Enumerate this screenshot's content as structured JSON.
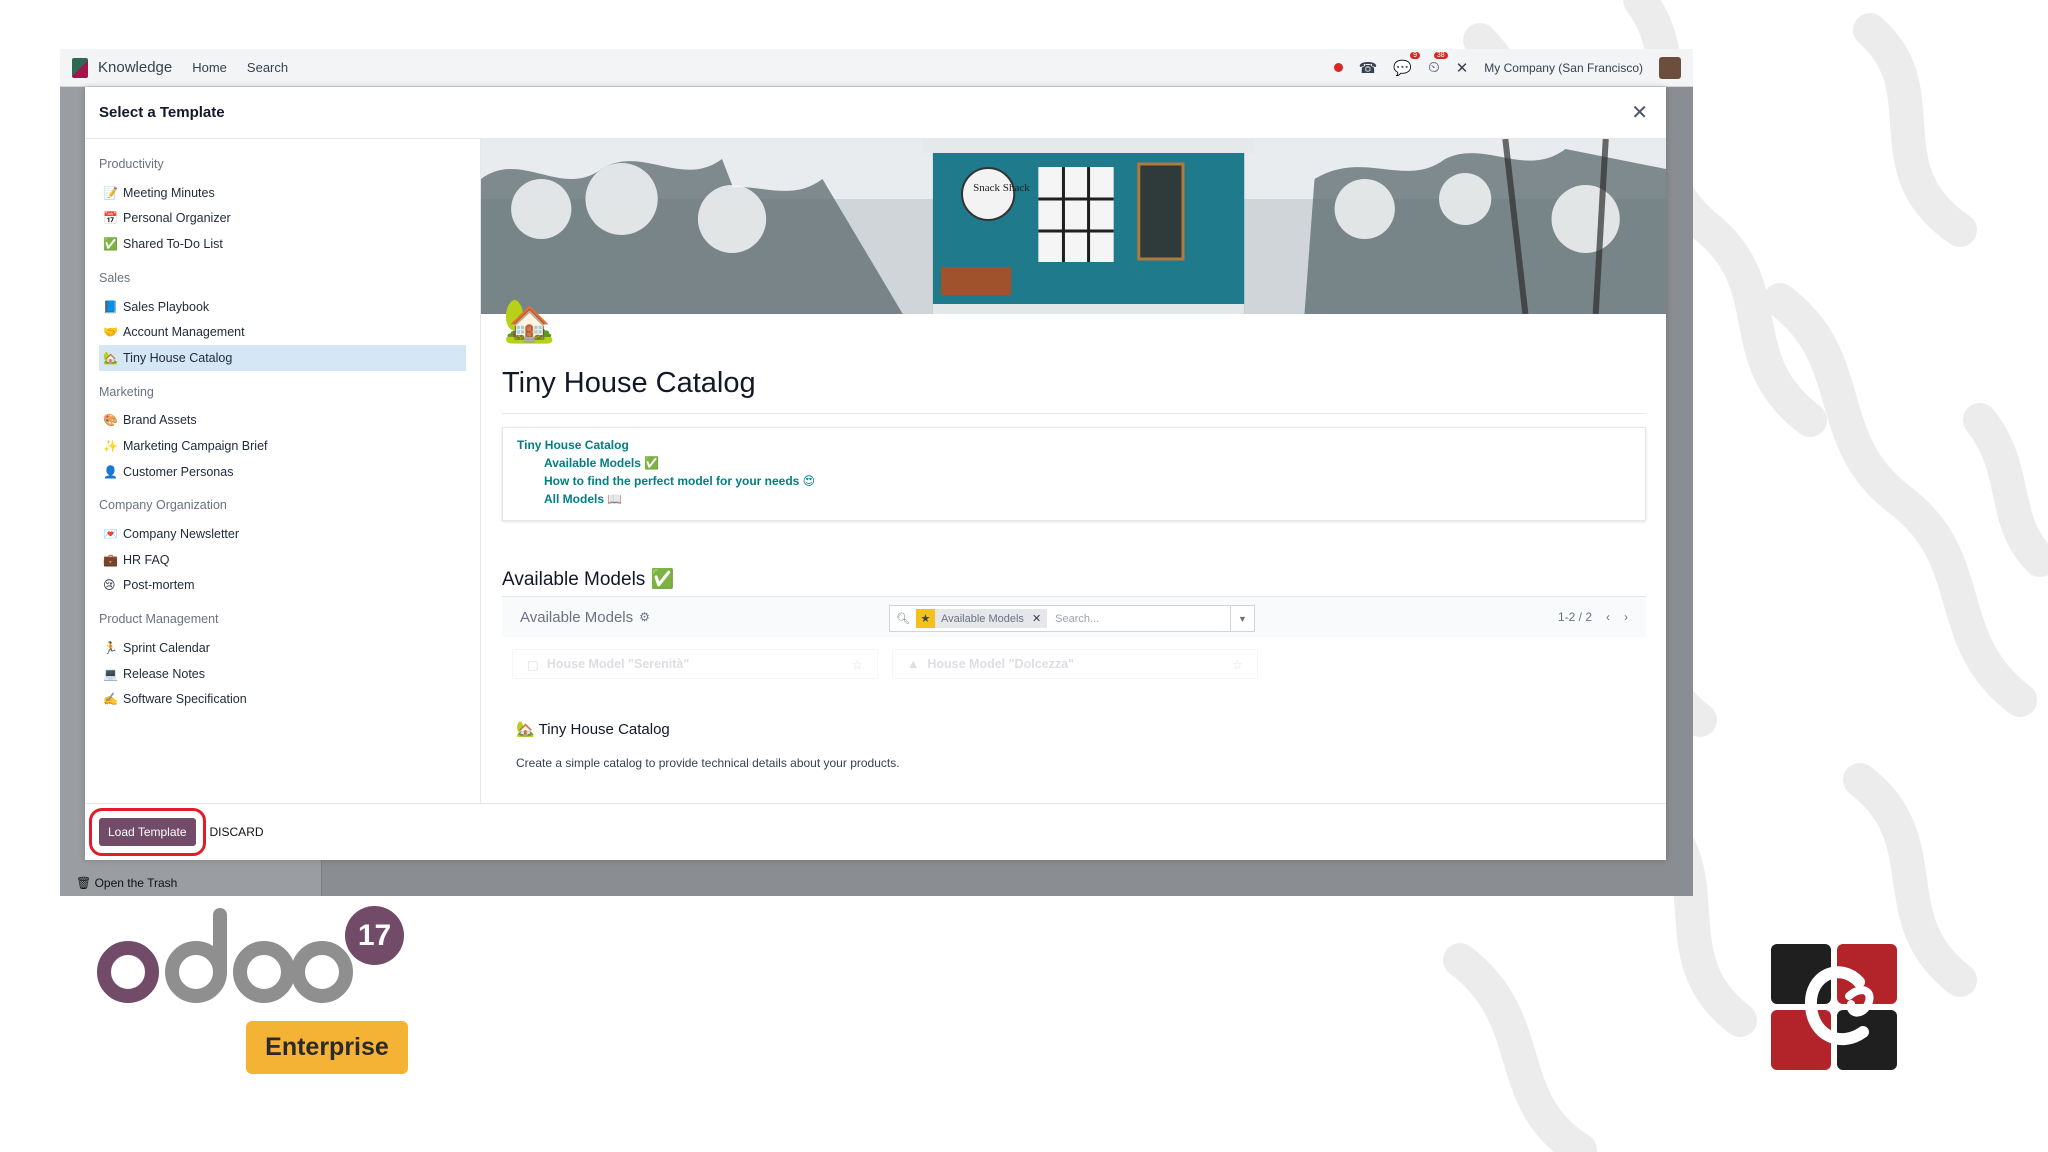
{
  "app": {
    "name": "Knowledge",
    "menu": [
      "Home",
      "Search"
    ],
    "company": "My Company (San Francisco)",
    "badge_chat": "9",
    "badge_activity": "38",
    "trash_label": "Open the Trash",
    "trash_icon": "trash-icon"
  },
  "modal": {
    "title": "Select a Template",
    "categories": [
      {
        "title": "Productivity",
        "items": [
          {
            "emoji": "📝",
            "label": "Meeting Minutes"
          },
          {
            "emoji": "📅",
            "label": "Personal Organizer"
          },
          {
            "emoji": "✅",
            "label": "Shared To-Do List"
          }
        ]
      },
      {
        "title": "Sales",
        "items": [
          {
            "emoji": "📘",
            "label": "Sales Playbook"
          },
          {
            "emoji": "🤝",
            "label": "Account Management"
          },
          {
            "emoji": "🏡",
            "label": "Tiny House Catalog"
          }
        ]
      },
      {
        "title": "Marketing",
        "items": [
          {
            "emoji": "🎨",
            "label": "Brand Assets"
          },
          {
            "emoji": "✨",
            "label": "Marketing Campaign Brief"
          },
          {
            "emoji": "👤",
            "label": "Customer Personas"
          }
        ]
      },
      {
        "title": "Company Organization",
        "items": [
          {
            "emoji": "💌",
            "label": "Company Newsletter"
          },
          {
            "emoji": "💼",
            "label": "HR FAQ"
          },
          {
            "emoji": "😢",
            "label": "Post-mortem"
          }
        ]
      },
      {
        "title": "Product Management",
        "items": [
          {
            "emoji": "🏃",
            "label": "Sprint Calendar"
          },
          {
            "emoji": "💻",
            "label": "Release Notes"
          },
          {
            "emoji": "✍️",
            "label": "Software Specification"
          }
        ]
      }
    ],
    "selected": "Tiny House Catalog",
    "preview": {
      "cover_sign_text": "Snack Shack",
      "icon": "🏡",
      "title": "Tiny House Catalog",
      "toc": {
        "root": "Tiny House Catalog",
        "children": [
          "Available Models ✅",
          "How to find the perfect model for your needs 😍",
          "All Models 📖"
        ]
      },
      "section_title": "Available Models ✅",
      "embedded_view": {
        "title": "Available Models",
        "facet": "Available Models",
        "search_placeholder": "Search...",
        "pager": "1-2 / 2",
        "cards": [
          "House Model \"Serenità\"",
          "House Model \"Dolcezza\""
        ]
      },
      "template_name": "Tiny House Catalog",
      "template_description": "Create a simple catalog to provide technical details about your products."
    },
    "load_button": "Load Template",
    "discard_button": "DISCARD"
  },
  "branding": {
    "product": "odoo",
    "version": "17",
    "edition": "Enterprise",
    "colors": {
      "odoo_purple": "#714b67",
      "odoo_grey": "#8f8f8f",
      "enterprise_yellow": "#f5b335",
      "partner_red": "#b3242a"
    }
  }
}
